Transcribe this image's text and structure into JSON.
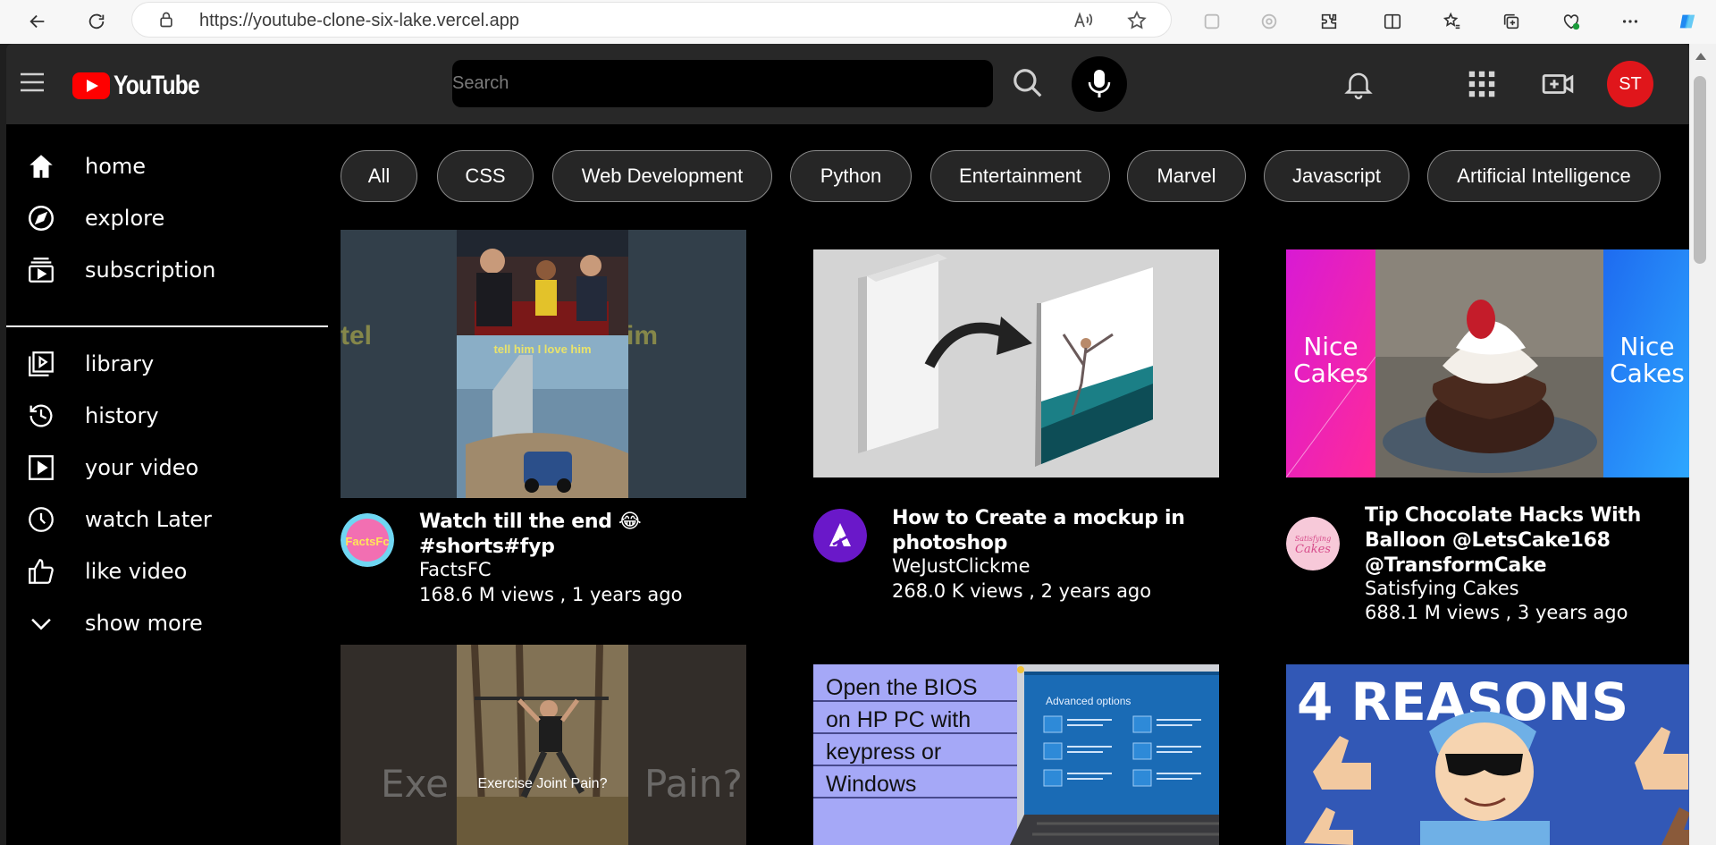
{
  "browser": {
    "url_prefix": "https://",
    "url_host": "youtube-clone-six-lake.vercel.app",
    "profile_colors": {
      "copilot": "#1f8af2"
    }
  },
  "header": {
    "logo_text": "YouTube",
    "search_placeholder": "Search",
    "avatar_initials": "ST",
    "icons": [
      "menu-icon",
      "search-icon",
      "mic-icon",
      "bell-icon",
      "apps-grid-icon",
      "create-video-icon"
    ]
  },
  "sidebar": {
    "items": [
      {
        "label": "home",
        "icon": "home-icon"
      },
      {
        "label": "explore",
        "icon": "compass-icon"
      },
      {
        "label": "subscription",
        "icon": "subscriptions-icon"
      },
      {
        "label": "library",
        "icon": "library-icon"
      },
      {
        "label": "history",
        "icon": "history-icon"
      },
      {
        "label": "your video",
        "icon": "play-square-icon"
      },
      {
        "label": "watch Later",
        "icon": "clock-icon"
      },
      {
        "label": "like video",
        "icon": "thumbs-up-icon"
      },
      {
        "label": "show more",
        "icon": "chevron-down-icon"
      }
    ]
  },
  "chips": [
    "All",
    "CSS",
    "Web Development",
    "Python",
    "Entertainment",
    "Marvel",
    "Javascript",
    "Artificial Intelligence"
  ],
  "videos": [
    {
      "title": "Watch till the end 😂 #shorts#fyp",
      "channel": "FactsFC",
      "stats": "168.6 M views , 1 years ago",
      "thumb_caption_top": "tell him I love him",
      "avatar_text": "FactsFc"
    },
    {
      "title": "How to Create a mockup in photoshop",
      "channel": "WeJustClickme",
      "stats": "268.0 K views , 2 years ago"
    },
    {
      "title": "Tip Chocolate Hacks With Balloon @LetsCake168 @TransformCake",
      "channel": "Satisfying Cakes",
      "stats": "688.1 M views , 3 years ago",
      "thumb_left_text": "Nice Cakes",
      "thumb_right_text": "Nice Cakes",
      "avatar_text": "Satisfying Cakes"
    },
    {
      "thumb_caption": "Exercise Joint Pain?",
      "thumb_bg_text": "Exe Pain?"
    },
    {
      "thumb_lines": [
        "Open the BIOS",
        "on HP PC with",
        "keypress or",
        "Windows"
      ],
      "thumb_panel_title": "Advanced options"
    },
    {
      "thumb_text": "4 REASONS"
    }
  ]
}
